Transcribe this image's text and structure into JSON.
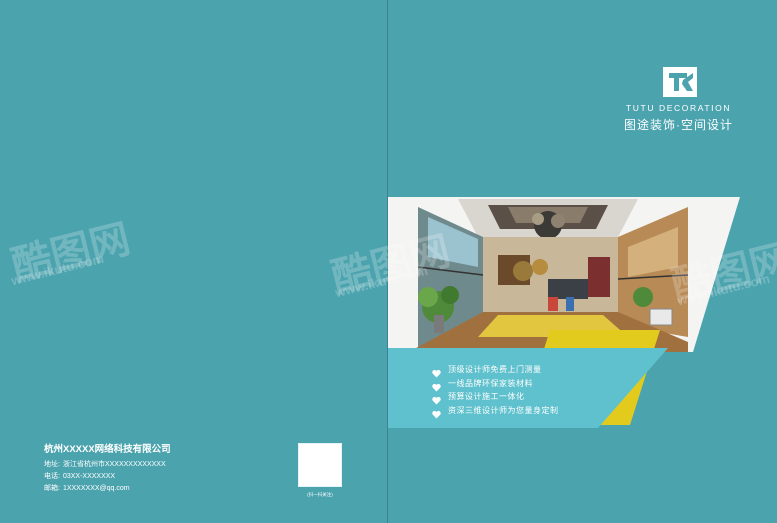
{
  "brand": {
    "name_en": "TUTU DECORATION",
    "name_cn": "图途装饰·空间设计"
  },
  "features": [
    "顶级设计师免费上门测量",
    "一线品牌环保家装材料",
    "预算设计施工一体化",
    "资深三维设计师为您量身定制"
  ],
  "contact": {
    "company": "杭州XXXXX网络科技有限公司",
    "address_label": "地址:",
    "address": "浙江省杭州市XXXXXXXXXXXXX",
    "phone_label": "电话:",
    "phone": "03XX-XXXXXXX",
    "email_label": "邮箱:",
    "email": "1XXXXXXX@qq.com"
  },
  "qr_caption": "(扫一扫关注)",
  "watermark": {
    "cn": "酷图网",
    "url": "www.ikutu.com"
  },
  "colors": {
    "background": "#4ba3ae",
    "band_teal": "#5fc1cd",
    "band_yellow": "#e3cb1e",
    "text": "#ffffff"
  }
}
